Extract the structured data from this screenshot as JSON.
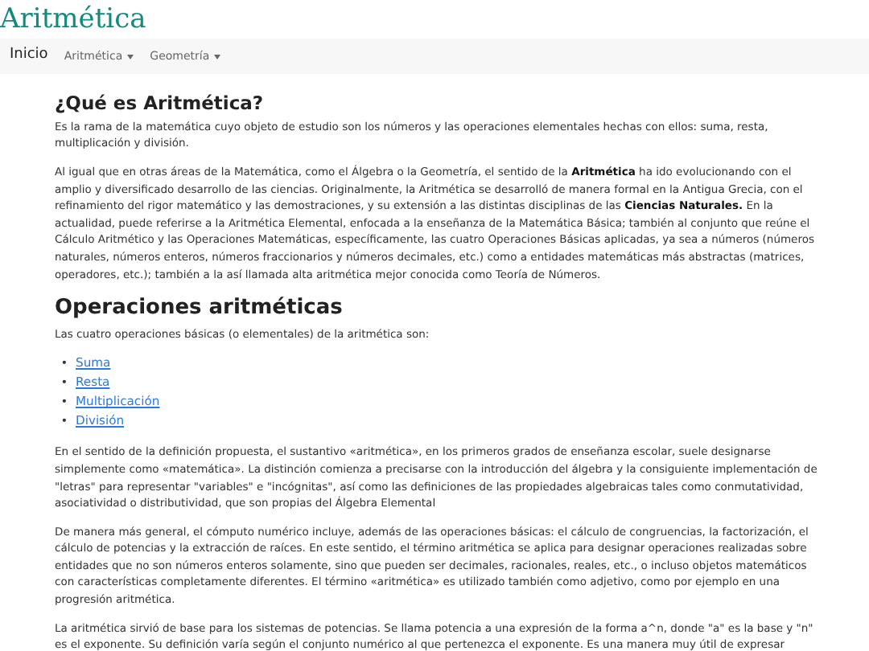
{
  "site_title": "Aritmética",
  "navbar": {
    "brand": "Inicio",
    "menus": [
      {
        "label": "Aritmética"
      },
      {
        "label": "Geometría"
      }
    ]
  },
  "sections": [
    {
      "heading": "¿Qué es Aritmética?",
      "blocks": [
        {
          "kind": "paragraph",
          "text": "Es la rama de la matemática cuyo objeto de estudio son los números y las operaciones elementales hechas con ellos: suma, resta, multiplicación y división."
        },
        {
          "kind": "paragraph",
          "text": "Al igual que en otras áreas de la Matemática, como el Álgebra o la Geometría, el sentido de la **Aritmética** ha ido evolucionando con el amplio y diversificado desarrollo de las ciencias. Originalmente, la Aritmética se desarrolló de manera formal en la Antigua Grecia, con el refinamiento del rigor matemático y las demostraciones, y su extensión a las distintas disciplinas de las **Ciencias Naturales.** En la actualidad, puede referirse a la Aritmética Elemental, enfocada a la enseñanza de la Matemática Básica; también al conjunto que reúne el Cálculo Aritmético y las Operaciones Matemáticas, específicamente, las cuatro Operaciones Básicas aplicadas, ya sea a números (números naturales, números enteros, números fraccionarios y números decimales, etc.) como a entidades matemáticas más abstractas (matrices, operadores, etc.); también a la así llamada alta aritmética mejor conocida como Teoría de Números."
        }
      ]
    },
    {
      "heading": "Operaciones aritméticas",
      "blocks": [
        {
          "kind": "paragraph",
          "text": "Las cuatro operaciones básicas (o elementales) de la aritmética son:"
        },
        {
          "kind": "links",
          "items": [
            {
              "marker": "•",
              "label": "Suma"
            },
            {
              "marker": "•",
              "label": "Resta"
            },
            {
              "marker": "•",
              "label": "Multiplicación"
            },
            {
              "marker": "•",
              "label": "División"
            }
          ]
        },
        {
          "kind": "paragraph",
          "text": "En el sentido de la definición propuesta, el sustantivo «aritmética», en los primeros grados de enseñanza escolar, suele designarse simplemente como «matemática». La distinción comienza a precisarse con la introducción del álgebra y la consiguiente implementación de \"letras\" para representar \"variables\" e \"incógnitas\", así como las definiciones de las propiedades algebraicas tales como conmutatividad, asociatividad o distributividad, que son propias del Álgebra Elemental"
        },
        {
          "kind": "paragraph",
          "text": "De manera más general, el cómputo numérico incluye, además de las operaciones básicas: el cálculo de congruencias, la factorización, el cálculo de potencias y la extracción de raíces. En este sentido, el término aritmética se aplica para designar operaciones realizadas sobre entidades que no son números enteros solamente, sino que pueden ser decimales, racionales, reales, etc., o incluso objetos matemáticos con características completamente diferentes. El término «aritmética» es utilizado también como adjetivo, como por ejemplo en una progresión aritmética."
        },
        {
          "kind": "paragraph",
          "text": "La aritmética sirvió de base para los sistemas de potencias. Se llama potencia a una expresión de la forma a^n, donde \"a\" es la base y \"n\" es el exponente. Su definición varía según el conjunto numérico al que pertenezca el exponente. Es una manera muy útil de expresar"
        }
      ]
    }
  ]
}
